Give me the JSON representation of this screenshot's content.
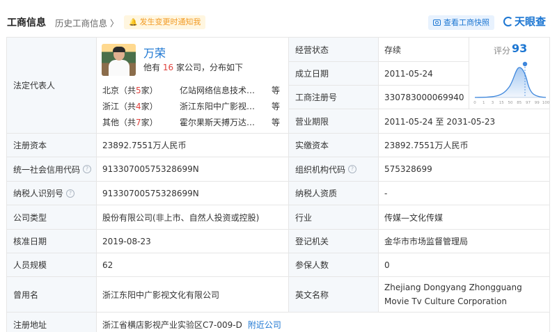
{
  "header": {
    "title": "工商信息",
    "history": "历史工商信息 〉",
    "notify": "发生变更时通知我",
    "snapshot": "查看工商快照",
    "logo": "天眼查"
  },
  "legal_rep": {
    "label": "法定代表人",
    "name": "万荣",
    "summary_pre": "他有",
    "summary_count": "16",
    "summary_post": "家公司，分布如下",
    "regions": [
      {
        "name": "北京（共",
        "count": "5",
        "suffix": "家）",
        "company": "亿站网络信息技术（...",
        "more": "等"
      },
      {
        "name": "浙江（共",
        "count": "4",
        "suffix": "家）",
        "company": "浙江东阳中广影视文...",
        "more": "等"
      },
      {
        "name": "其他（共",
        "count": "7",
        "suffix": "家）",
        "company": "霍尔果斯天搏万达影...",
        "more": "等"
      }
    ]
  },
  "right_top": {
    "status_label": "经营状态",
    "status_value": "存续",
    "founded_label": "成立日期",
    "founded_value": "2011-05-24",
    "regno_label": "工商注册号",
    "regno_value": "330783000069940",
    "term_label": "营业期限",
    "term_value": "2011-05-24  至 2031-05-23"
  },
  "score": {
    "label": "评分",
    "value": "93",
    "ticks": [
      "0",
      "1",
      "3",
      "15",
      "50",
      "85",
      "97",
      "99",
      "100"
    ]
  },
  "rows": [
    {
      "l1": "注册资本",
      "v1": "23892.7551万人民币",
      "l2": "实缴资本",
      "v2": "23892.7551万人民币"
    },
    {
      "l1": "统一社会信用代码",
      "v1": "91330700575328699N",
      "l2": "组织机构代码",
      "v2": "575328699"
    },
    {
      "l1": "纳税人识别号",
      "v1": "91330700575328699N",
      "l2": "纳税人资质",
      "v2": "-"
    },
    {
      "l1": "公司类型",
      "v1": "股份有限公司(非上市、自然人投资或控股)",
      "l2": "行业",
      "v2": "传媒—文化传媒"
    },
    {
      "l1": "核准日期",
      "v1": "2019-08-23",
      "l2": "登记机关",
      "v2": "金华市市场监督管理局"
    },
    {
      "l1": "人员规模",
      "v1": "62",
      "l2": "参保人数",
      "v2": "0"
    },
    {
      "l1": "曾用名",
      "v1": "浙江东阳中广影视文化有限公司",
      "l2": "英文名称",
      "v2": "Zhejiang Dongyang Zhongguang Movie Tv Culture Corporation"
    }
  ],
  "address": {
    "label": "注册地址",
    "value": "浙江省横店影视产业实验区C7-009-D",
    "link": "附近公司"
  },
  "help_icon": "?",
  "colors": {
    "accent": "#1c76d2",
    "red": "#e0413c",
    "label_bg": "#f5f8fb",
    "notify": "#f29b25"
  }
}
